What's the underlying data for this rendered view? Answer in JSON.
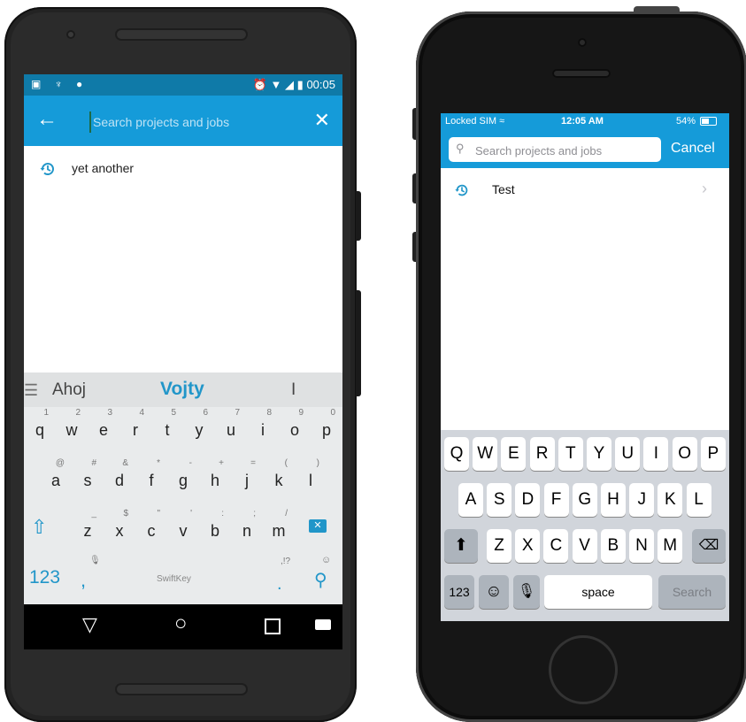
{
  "android": {
    "status_time": "00:05",
    "search_placeholder": "Search projects and jobs",
    "back_icon": "←",
    "close_icon": "✕",
    "history_item": "yet another",
    "predictions": [
      "Ahoj",
      "Vojty",
      "I"
    ],
    "keys": {
      "row1": [
        [
          "q",
          "1"
        ],
        [
          "w",
          "2"
        ],
        [
          "e",
          "3"
        ],
        [
          "r",
          "4"
        ],
        [
          "t",
          "5"
        ],
        [
          "y",
          "6"
        ],
        [
          "u",
          "7"
        ],
        [
          "i",
          "8"
        ],
        [
          "o",
          "9"
        ],
        [
          "p",
          "0"
        ]
      ],
      "row2": [
        [
          "a",
          "@"
        ],
        [
          "s",
          "#"
        ],
        [
          "d",
          "&"
        ],
        [
          "f",
          "*"
        ],
        [
          "g",
          "-"
        ],
        [
          "h",
          "+"
        ],
        [
          "j",
          "="
        ],
        [
          "k",
          "("
        ],
        [
          "l",
          ")"
        ]
      ],
      "row3": [
        [
          "z",
          "_"
        ],
        [
          "x",
          "$"
        ],
        [
          "c",
          "\""
        ],
        [
          "v",
          "'"
        ],
        [
          "b",
          ":"
        ],
        [
          "n",
          ";"
        ],
        [
          "m",
          "/"
        ]
      ]
    },
    "key_123": "123",
    "key_comma": ",",
    "key_period": ".",
    "swiftkey": "SwiftKey",
    "accent": "#159bd9",
    "status_bar_color": "#0f7aa8"
  },
  "iphone": {
    "carrier": "Locked SIM",
    "time": "12:05 AM",
    "battery": "54%",
    "search_placeholder": "Search projects and jobs",
    "cancel": "Cancel",
    "history_item": "Test",
    "keys": {
      "row1": [
        "Q",
        "W",
        "E",
        "R",
        "T",
        "Y",
        "U",
        "I",
        "O",
        "P"
      ],
      "row2": [
        "A",
        "S",
        "D",
        "F",
        "G",
        "H",
        "J",
        "K",
        "L"
      ],
      "row3": [
        "Z",
        "X",
        "C",
        "V",
        "B",
        "N",
        "M"
      ]
    },
    "key_123": "123",
    "key_space": "space",
    "key_search": "Search",
    "accent": "#159bd9"
  }
}
